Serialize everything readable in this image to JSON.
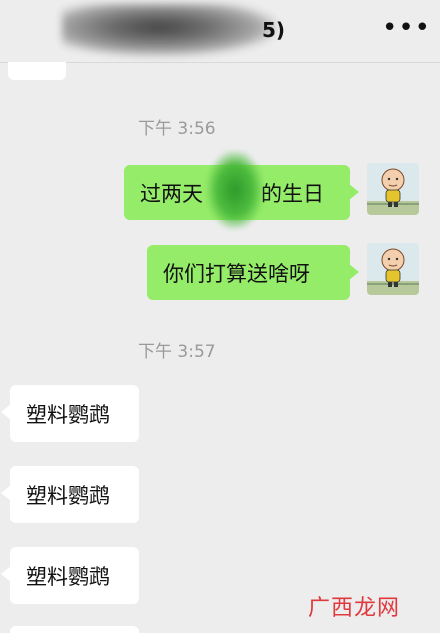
{
  "header": {
    "title_visible_tail": "5)",
    "more_icon": "ellipsis-icon",
    "more_glyph": "•••"
  },
  "times": [
    "下午 3:56",
    "下午 3:57"
  ],
  "messages_me": [
    "过两天",
    "的生日",
    "你们打算送啥呀"
  ],
  "messages_other": [
    "塑料鹦鹉",
    "塑料鹦鹉",
    "塑料鹦鹉"
  ],
  "watermark": "广西龙网",
  "colors": {
    "background": "#ededed",
    "my_bubble": "#95ec69",
    "other_bubble": "#ffffff",
    "watermark": "#e0393e"
  }
}
